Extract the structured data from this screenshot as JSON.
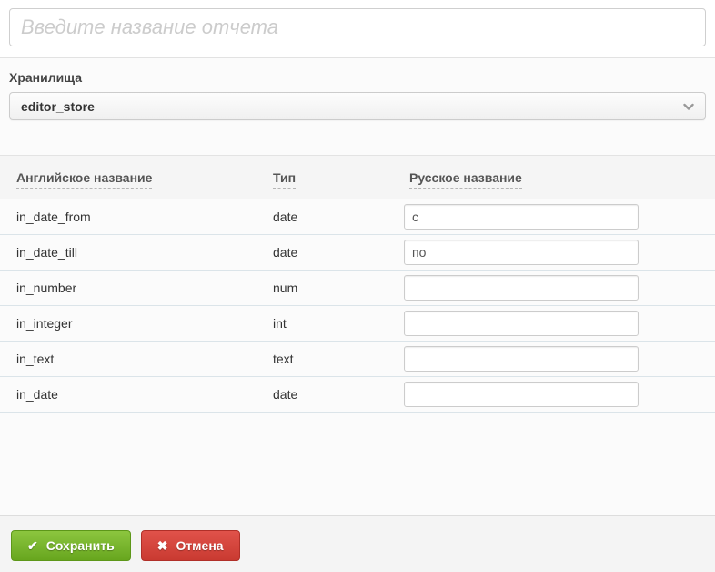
{
  "report_name_input": {
    "placeholder": "Введите название отчета",
    "value": ""
  },
  "storage": {
    "label": "Хранилища",
    "selected": "editor_store",
    "chevron_icon": "chevron-down"
  },
  "params_table": {
    "columns": [
      {
        "label": "Английское название"
      },
      {
        "label": "Тип"
      },
      {
        "label": "Русское название"
      }
    ],
    "rows": [
      {
        "en": "in_date_from",
        "type": "date",
        "ru": "с"
      },
      {
        "en": "in_date_till",
        "type": "date",
        "ru": "по"
      },
      {
        "en": "in_number",
        "type": "num",
        "ru": ""
      },
      {
        "en": "in_integer",
        "type": "int",
        "ru": ""
      },
      {
        "en": "in_text",
        "type": "text",
        "ru": ""
      },
      {
        "en": "in_date",
        "type": "date",
        "ru": ""
      }
    ]
  },
  "actions": {
    "save_label": "Сохранить",
    "save_icon": "✔",
    "cancel_label": "Отмена",
    "cancel_icon": "✖"
  },
  "colors": {
    "save_green": "#76b82a",
    "cancel_red": "#d9453c",
    "table_border": "#dbe4e9",
    "header_bg": "#f5f5f5"
  }
}
